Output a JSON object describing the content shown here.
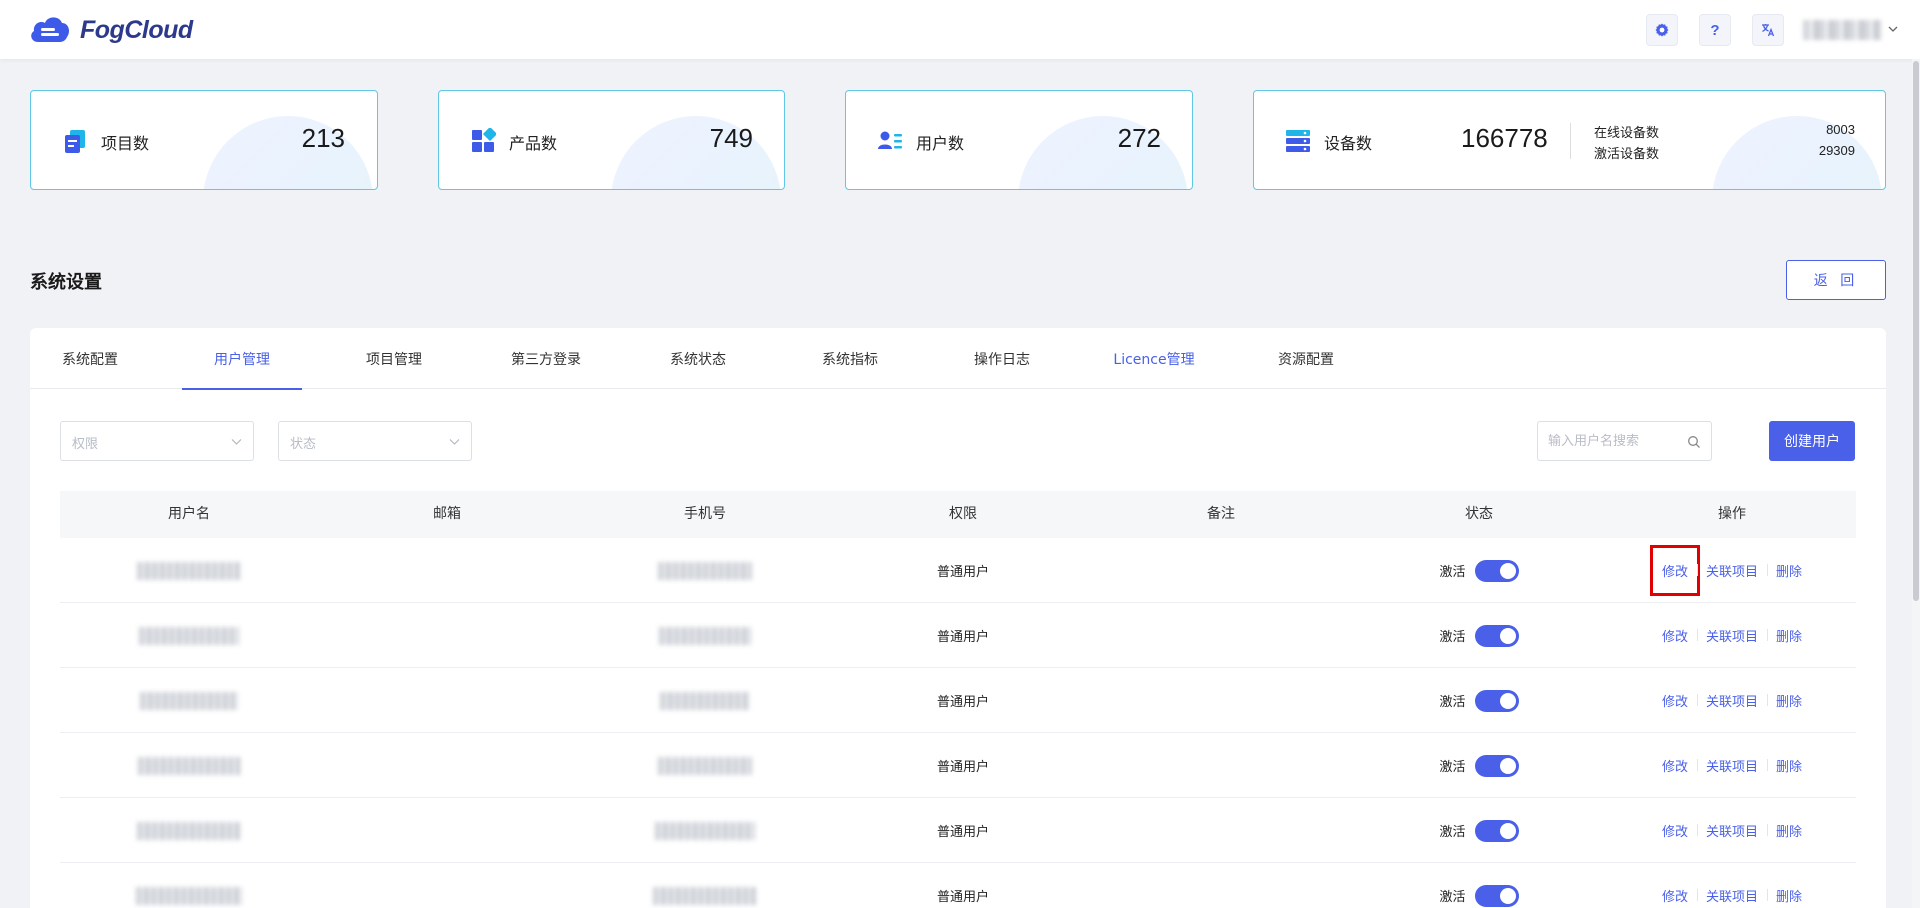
{
  "app": {
    "brand": "FogCloud"
  },
  "header": {
    "user_name": ""
  },
  "stats": [
    {
      "label": "项目数",
      "value": "213",
      "icon": "project-icon"
    },
    {
      "label": "产品数",
      "value": "749",
      "icon": "product-icon"
    },
    {
      "label": "用户数",
      "value": "272",
      "icon": "users-icon"
    },
    {
      "label": "设备数",
      "value": "166778",
      "icon": "device-icon",
      "sub": [
        {
          "label": "在线设备数",
          "value": "8003"
        },
        {
          "label": "激活设备数",
          "value": "29309"
        }
      ]
    }
  ],
  "section": {
    "title": "系统设置",
    "back_label": "返 回"
  },
  "tabs": [
    "系统配置",
    "用户管理",
    "项目管理",
    "第三方登录",
    "系统状态",
    "系统指标",
    "操作日志",
    "Licence管理",
    "资源配置"
  ],
  "active_tab": "用户管理",
  "filters": {
    "permission_placeholder": "权限",
    "status_placeholder": "状态",
    "search_placeholder": "输入用户名搜索",
    "create_label": "创建用户"
  },
  "table": {
    "columns": [
      "用户名",
      "邮箱",
      "手机号",
      "权限",
      "备注",
      "状态",
      "操作"
    ],
    "rows": [
      {
        "permission": "普通用户",
        "status": "激活",
        "active": true
      },
      {
        "permission": "普通用户",
        "status": "激活",
        "active": true
      },
      {
        "permission": "普通用户",
        "status": "激活",
        "active": true
      },
      {
        "permission": "普通用户",
        "status": "激活",
        "active": true
      },
      {
        "permission": "普通用户",
        "status": "激活",
        "active": true
      },
      {
        "permission": "普通用户",
        "status": "激活",
        "active": true
      }
    ],
    "actions": {
      "edit": "修改",
      "link_project": "关联项目",
      "delete": "删除"
    }
  },
  "colors": {
    "accent": "#4a60e8",
    "card_border": "#5ec8e5",
    "highlight_box": "#e00000"
  }
}
